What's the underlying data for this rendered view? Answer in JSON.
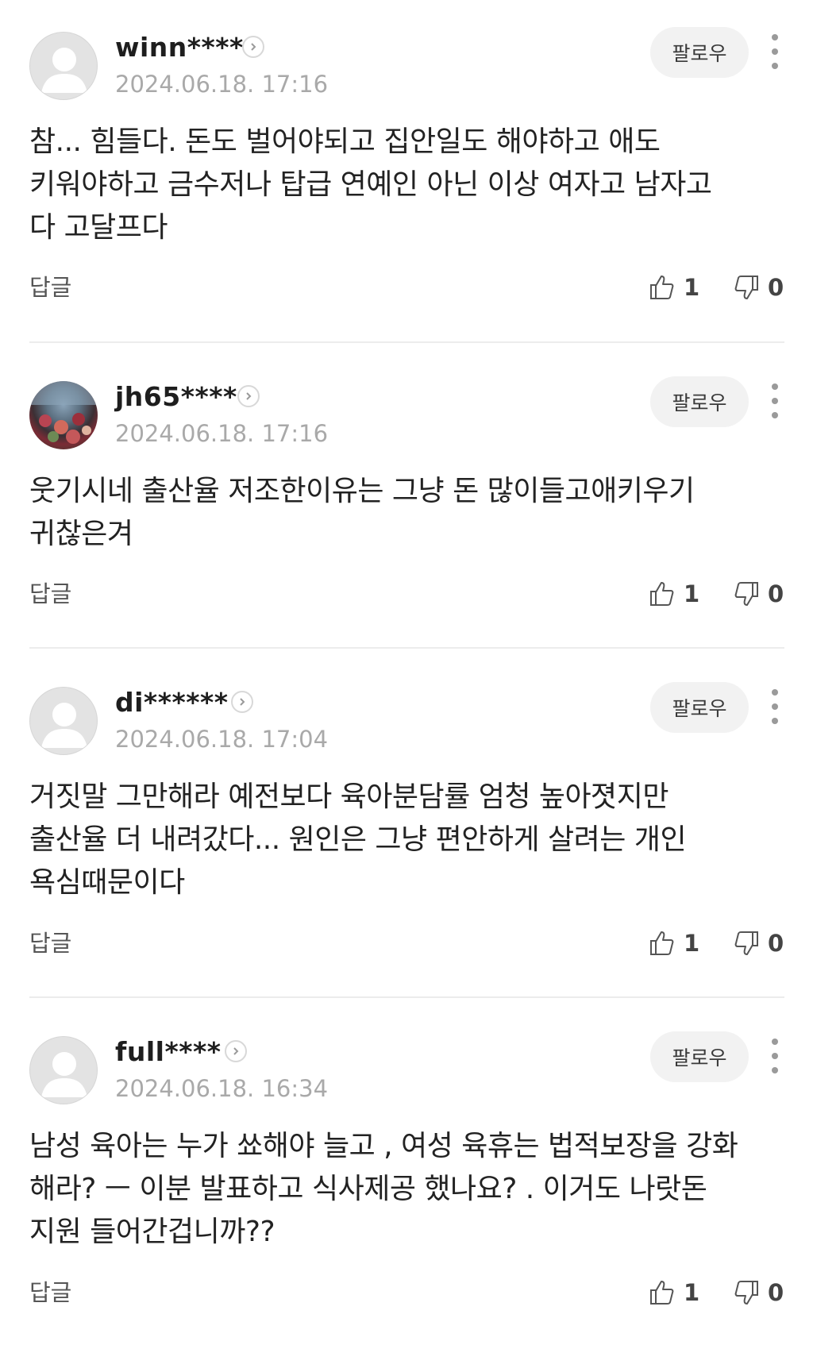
{
  "comments": [
    {
      "username": "winn****",
      "timestamp": "2024.06.18. 17:16",
      "follow_label": "팔로우",
      "text": "참... 힘들다. 돈도 벌어야되고 집안일도 해야하고 애도 키워야하고 금수저나 탑급 연예인 아닌 이상 여자고 남자고 다 고달프다",
      "reply_label": "답글",
      "likes": "1",
      "dislikes": "0",
      "avatar": "default"
    },
    {
      "username": "jh65****",
      "timestamp": "2024.06.18. 17:16",
      "follow_label": "팔로우",
      "text": "웃기시네 출산율 저조한이유는 그냥 돈 많이들고애키우기 귀찮은겨",
      "reply_label": "답글",
      "likes": "1",
      "dislikes": "0",
      "avatar": "photo"
    },
    {
      "username": "di******",
      "timestamp": "2024.06.18. 17:04",
      "follow_label": "팔로우",
      "text": "거짓말 그만해라 예전보다 육아분담률 엄청 높아졋지만 출산율 더 내려갔다... 원인은 그냥 편안하게 살려는 개인 욕심때문이다",
      "reply_label": "답글",
      "likes": "1",
      "dislikes": "0",
      "avatar": "default"
    },
    {
      "username": "full****",
      "timestamp": "2024.06.18. 16:34",
      "follow_label": "팔로우",
      "text": "남성 육아는 누가 쑈해야 늘고 , 여성 육휴는 법적보장을 강화 해라? ㅡ 이분 발표하고 식사제공 했나요? . 이거도 나랏돈 지원 들어간겁니까??",
      "reply_label": "답글",
      "likes": "1",
      "dislikes": "0",
      "avatar": "default"
    }
  ],
  "icons": {
    "profile_arrow": "chevron-right-icon",
    "more": "more-vertical-icon",
    "like": "thumbs-up-icon",
    "dislike": "thumbs-down-icon"
  },
  "colors": {
    "follow_bg": "#f2f2f2",
    "timestamp": "#a9a9a9",
    "divider": "#ececec"
  }
}
